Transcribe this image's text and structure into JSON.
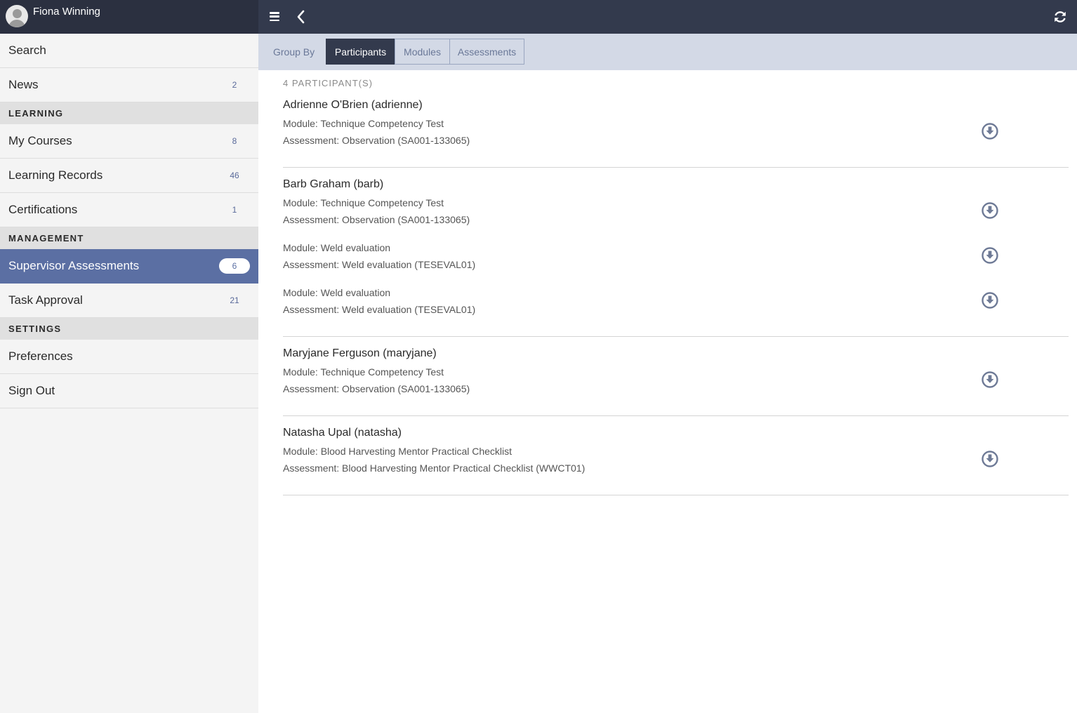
{
  "user": {
    "name": "Fiona Winning"
  },
  "nav": {
    "search": "Search",
    "news": {
      "label": "News",
      "count": "2"
    },
    "section_learning": "LEARNING",
    "my_courses": {
      "label": "My Courses",
      "count": "8"
    },
    "learning_records": {
      "label": "Learning Records",
      "count": "46"
    },
    "certifications": {
      "label": "Certifications",
      "count": "1"
    },
    "section_management": "MANAGEMENT",
    "supervisor_assessments": {
      "label": "Supervisor Assessments",
      "count": "6"
    },
    "task_approval": {
      "label": "Task Approval",
      "count": "21"
    },
    "section_settings": "SETTINGS",
    "preferences": "Preferences",
    "sign_out": "Sign Out"
  },
  "groupby": {
    "label": "Group By",
    "options": [
      "Participants",
      "Modules",
      "Assessments"
    ],
    "selected": "Participants"
  },
  "content": {
    "count_label": "4 PARTICIPANT(S)",
    "participants": [
      {
        "name": "Adrienne O'Brien (adrienne)",
        "items": [
          {
            "module": "Module: Technique Competency Test",
            "assessment": "Assessment: Observation (SA001-133065)"
          }
        ]
      },
      {
        "name": "Barb Graham (barb)",
        "items": [
          {
            "module": "Module: Technique Competency Test",
            "assessment": "Assessment: Observation (SA001-133065)"
          },
          {
            "module": "Module: Weld evaluation",
            "assessment": "Assessment: Weld evaluation (TESEVAL01)"
          },
          {
            "module": "Module: Weld evaluation",
            "assessment": "Assessment: Weld evaluation (TESEVAL01)"
          }
        ]
      },
      {
        "name": "Maryjane Ferguson (maryjane)",
        "items": [
          {
            "module": "Module: Technique Competency Test",
            "assessment": "Assessment: Observation (SA001-133065)"
          }
        ]
      },
      {
        "name": "Natasha Upal (natasha)",
        "items": [
          {
            "module": "Module: Blood Harvesting Mentor Practical Checklist",
            "assessment": "Assessment: Blood Harvesting Mentor Practical Checklist (WWCT01)"
          }
        ]
      }
    ]
  },
  "colors": {
    "topbar": "#333a4d",
    "sidebar_header": "#2b3040",
    "active_nav": "#5b6fa3",
    "groupbar": "#d3d9e6",
    "download_icon": "#6e7a96"
  }
}
